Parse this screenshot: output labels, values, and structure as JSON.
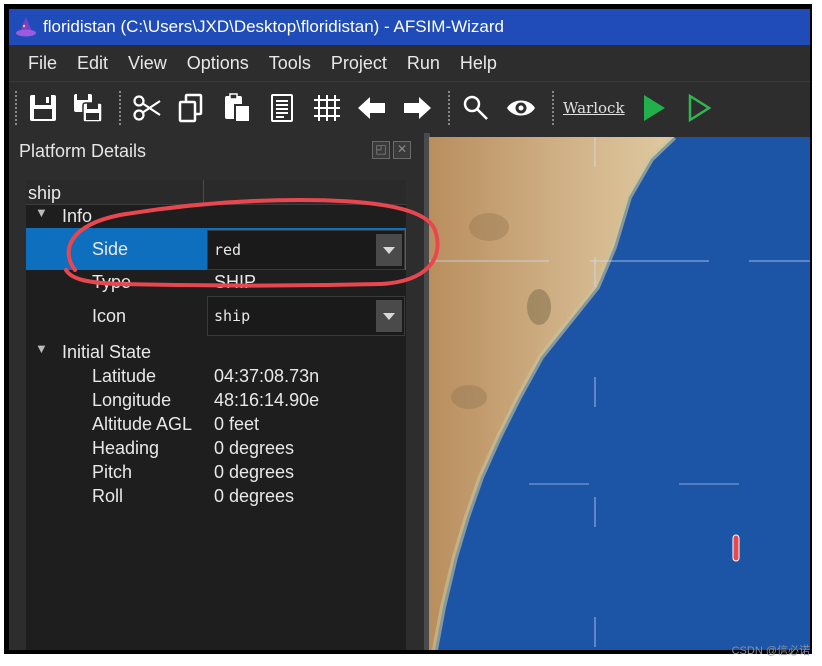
{
  "window": {
    "title": "floridistan (C:\\Users\\JXD\\Desktop\\floridistan) - AFSIM-Wizard"
  },
  "menu": [
    "File",
    "Edit",
    "View",
    "Options",
    "Tools",
    "Project",
    "Run",
    "Help"
  ],
  "toolbar": {
    "link_label": "Warlock",
    "icons": [
      "save-icon",
      "save-all-icon",
      "cut-icon",
      "copy-icon",
      "paste-icon",
      "document-icon",
      "grid-icon",
      "back-arrow-icon",
      "forward-arrow-icon",
      "search-icon",
      "eye-icon",
      "run-icon",
      "run-outline-icon"
    ],
    "colors": {
      "run": "#21b14c",
      "run_outline": "#2fb552"
    }
  },
  "panel": {
    "title": "Platform Details",
    "header": "ship",
    "sections": {
      "info": "Info",
      "initial_state": "Initial State"
    },
    "info_rows": {
      "side": {
        "label": "Side",
        "value": "red"
      },
      "type": {
        "label": "Type",
        "value": "SHIP"
      },
      "icon": {
        "label": "Icon",
        "value": "ship"
      }
    },
    "state_rows": [
      {
        "label": "Latitude",
        "value": "04:37:08.73n"
      },
      {
        "label": "Longitude",
        "value": "48:16:14.90e"
      },
      {
        "label": "Altitude AGL",
        "value": "0 feet"
      },
      {
        "label": "Heading",
        "value": "0 degrees"
      },
      {
        "label": "Pitch",
        "value": "0 degrees"
      },
      {
        "label": "Roll",
        "value": "0 degrees"
      }
    ],
    "selection_color": "#0f6fbf"
  },
  "map": {
    "colors": {
      "sea": "#1d55a6",
      "land": "#c8a676",
      "annotation": "#e8474f"
    }
  },
  "watermark": "CSDN @信必诺"
}
